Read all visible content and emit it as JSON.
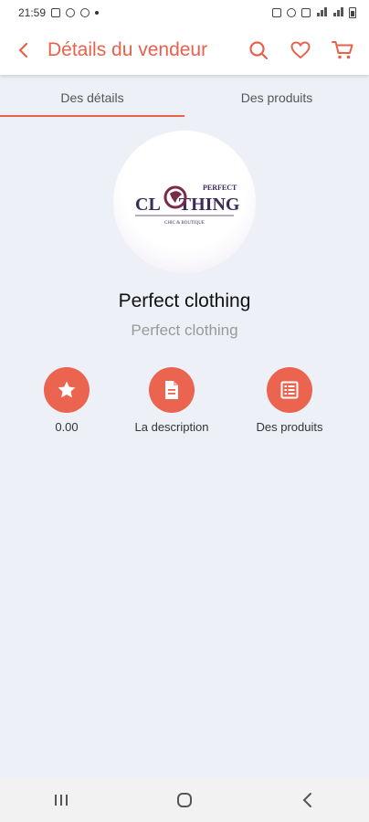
{
  "status_bar": {
    "time": "21:59"
  },
  "header": {
    "title": "Détails du vendeur"
  },
  "tabs": [
    {
      "label": "Des détails",
      "active": true
    },
    {
      "label": "Des produits",
      "active": false
    }
  ],
  "vendor": {
    "name": "Perfect clothing",
    "subtitle": "Perfect clothing",
    "logo_text": {
      "top": "PERFECT",
      "main": "CLOTHING",
      "tag": "CHIC & BOUTIQUE"
    }
  },
  "actions": [
    {
      "label": "0.00",
      "icon": "star-icon"
    },
    {
      "label": "La description",
      "icon": "document-icon"
    },
    {
      "label": "Des produits",
      "icon": "list-icon"
    }
  ],
  "colors": {
    "accent": "#e8614b",
    "background": "#edf1f7"
  }
}
